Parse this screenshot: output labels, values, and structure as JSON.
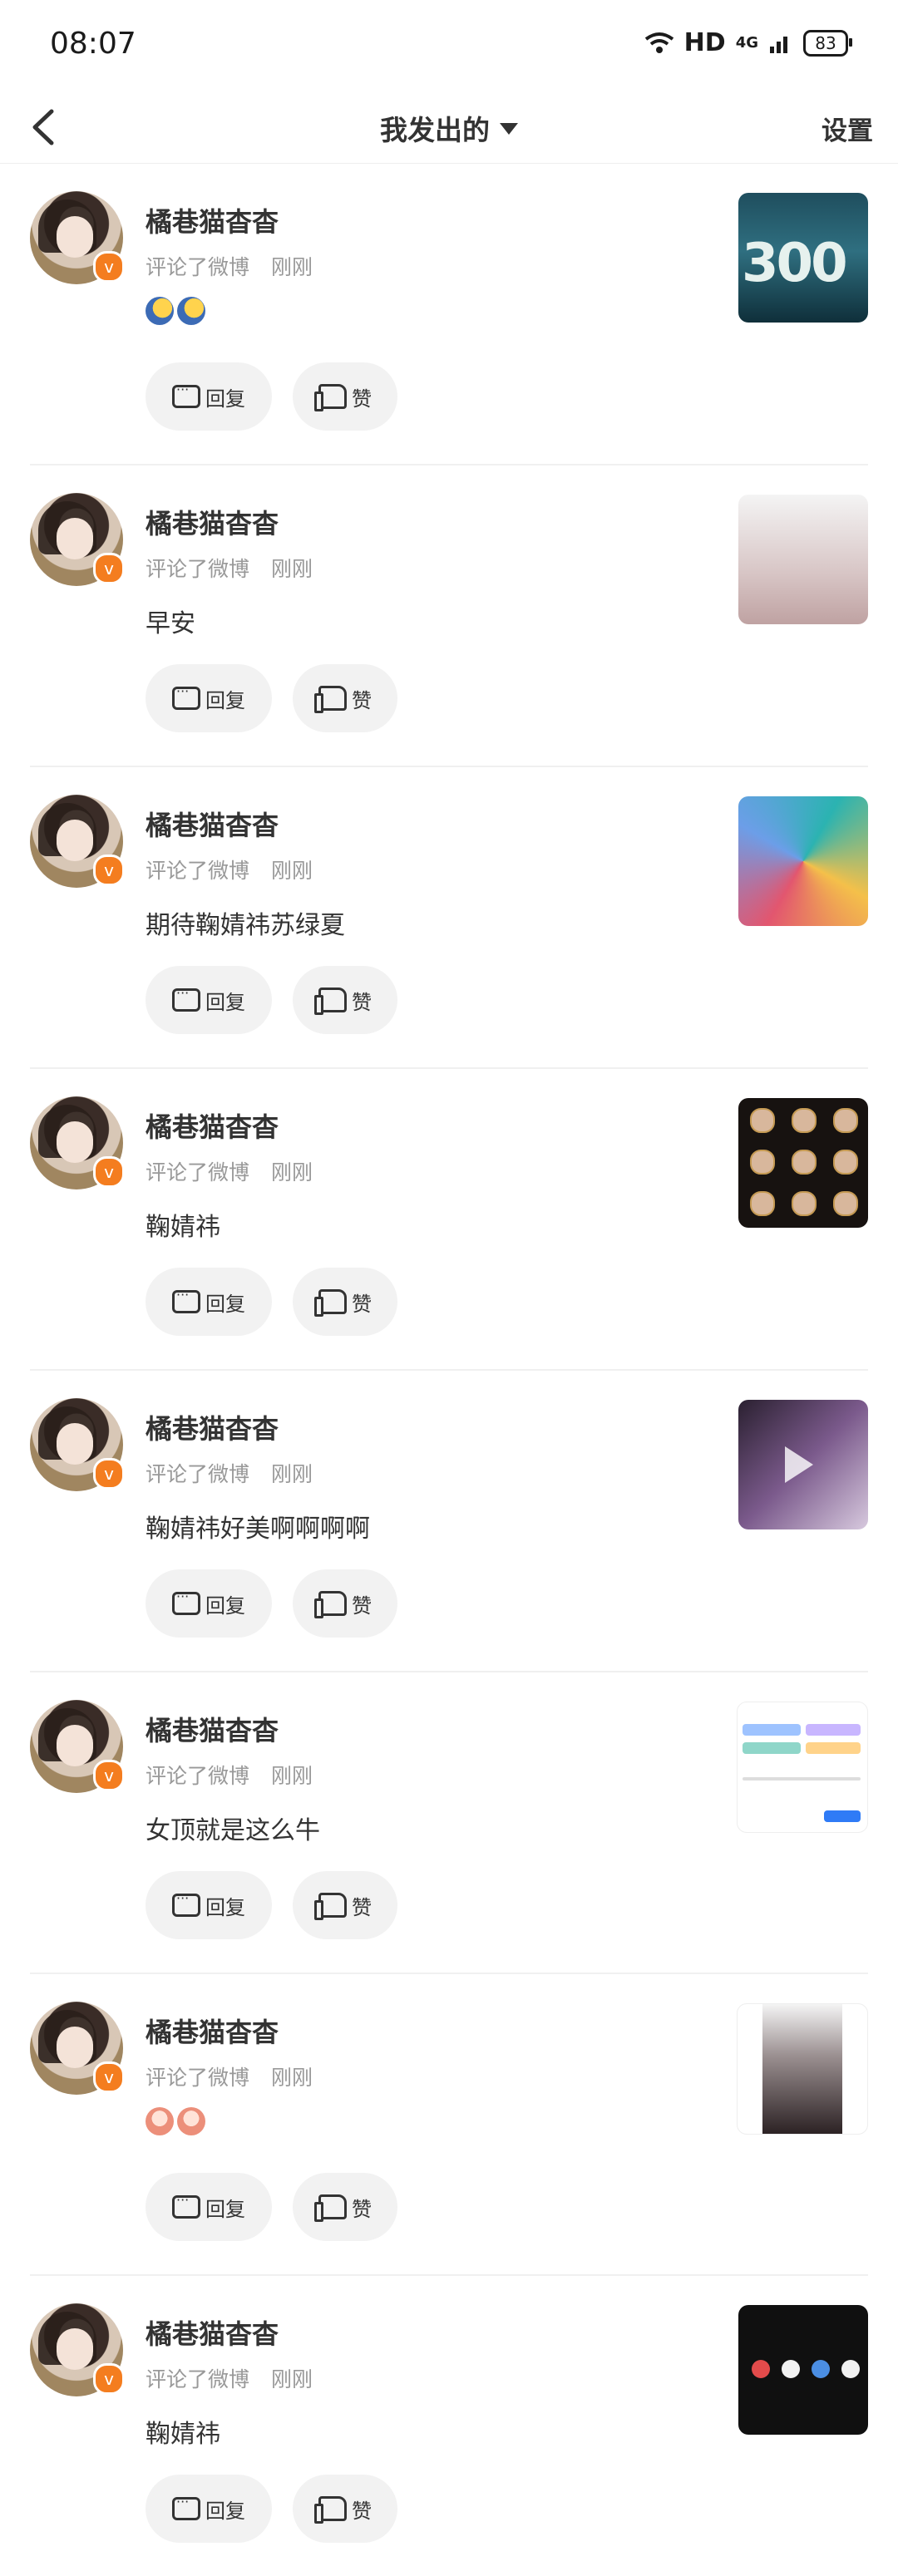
{
  "status": {
    "time": "08:07",
    "network": "HD",
    "signal": "4G",
    "battery": "83"
  },
  "nav": {
    "title": "我发出的",
    "settings": "设置"
  },
  "actions": {
    "reply": "回复",
    "like": "赞"
  },
  "posts": [
    {
      "user": "橘巷猫杳杳",
      "action": "评论了微博",
      "time": "刚刚",
      "comment": "",
      "emoji": "cheer",
      "thumb_text": "300"
    },
    {
      "user": "橘巷猫杳杳",
      "action": "评论了微博",
      "time": "刚刚",
      "comment": "早安",
      "emoji": "",
      "thumb_text": ""
    },
    {
      "user": "橘巷猫杳杳",
      "action": "评论了微博",
      "time": "刚刚",
      "comment": "期待鞠婧祎苏绿夏",
      "emoji": "",
      "thumb_text": ""
    },
    {
      "user": "橘巷猫杳杳",
      "action": "评论了微博",
      "time": "刚刚",
      "comment": "鞠婧祎",
      "emoji": "",
      "thumb_text": ""
    },
    {
      "user": "橘巷猫杳杳",
      "action": "评论了微博",
      "time": "刚刚",
      "comment": "鞠婧祎好美啊啊啊啊",
      "emoji": "",
      "thumb_text": ""
    },
    {
      "user": "橘巷猫杳杳",
      "action": "评论了微博",
      "time": "刚刚",
      "comment": "女顶就是这么牛",
      "emoji": "",
      "thumb_text": ""
    },
    {
      "user": "橘巷猫杳杳",
      "action": "评论了微博",
      "time": "刚刚",
      "comment": "",
      "emoji": "peach",
      "thumb_text": ""
    },
    {
      "user": "橘巷猫杳杳",
      "action": "评论了微博",
      "time": "刚刚",
      "comment": "鞠婧祎",
      "emoji": "",
      "thumb_text": ""
    }
  ]
}
